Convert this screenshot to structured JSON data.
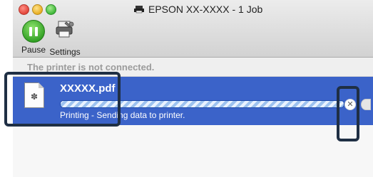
{
  "window": {
    "title": "EPSON XX-XXXX - 1 Job"
  },
  "toolbar": {
    "pause_label": "Pause",
    "settings_label": "Settings"
  },
  "status": {
    "message": "The printer is not connected."
  },
  "job": {
    "filename": "XXXXX.pdf",
    "status_text": "Printing - Sending data to printer.",
    "progress_percent": 100
  },
  "icons": {
    "close": "red-circle",
    "minimize": "yellow-circle",
    "zoom": "green-circle",
    "pause": "pause-icon",
    "settings": "printer-settings-icon",
    "document": "pdf-document-icon",
    "cancel": "cancel-icon"
  },
  "colors": {
    "selection": "#3b63c9",
    "callout": "#1f2f44"
  }
}
